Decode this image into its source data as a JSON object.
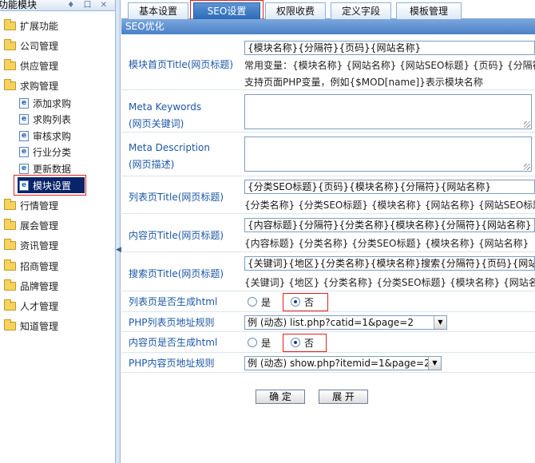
{
  "sidebar": {
    "header_title": "功能模块",
    "header_controls": "♦ 口 ✕",
    "folders": [
      {
        "label": "扩展功能"
      },
      {
        "label": "公司管理"
      },
      {
        "label": "供应管理"
      },
      {
        "label": "求购管理"
      },
      {
        "label": "行情管理"
      },
      {
        "label": "展会管理"
      },
      {
        "label": "资讯管理"
      },
      {
        "label": "招商管理"
      },
      {
        "label": "品牌管理"
      },
      {
        "label": "人才管理"
      },
      {
        "label": "知道管理"
      }
    ],
    "leaves": [
      {
        "label": "添加求购"
      },
      {
        "label": "求购列表"
      },
      {
        "label": "审核求购"
      },
      {
        "label": "行业分类"
      },
      {
        "label": "更新数据"
      },
      {
        "label": "模块设置"
      }
    ]
  },
  "tabs": [
    "基本设置",
    "SEO设置",
    "权限收费",
    "定义字段",
    "模板管理"
  ],
  "section_title": "SEO优化",
  "form": {
    "home_title": {
      "label": "模块首页Title(网页标题)",
      "value": "{模块名称}{分隔符}{页码}{网站名称}",
      "hint1": "常用变量：{模块名称} {网站名称} {网站SEO标题} {页码} {分隔符}",
      "hint2": "支持页面PHP变量，例如{$MOD[name]}表示模块名称"
    },
    "meta_keywords": {
      "label1": "Meta Keywords",
      "label2": "(网页关键词)"
    },
    "meta_description": {
      "label1": "Meta Description",
      "label2": "(网页描述)"
    },
    "list_title": {
      "label": "列表页Title(网页标题)",
      "value": "{分类SEO标题}{页码}{模块名称}{分隔符}{网站名称}",
      "hint": "{分类名称} {分类SEO标题} {模块名称} {网站名称} {网站SEO标题}"
    },
    "content_title": {
      "label": "内容页Title(网页标题)",
      "value": "{内容标题}{分隔符}{分类名称}{模块名称}{分隔符}{网站名称}",
      "hint": "{内容标题} {分类名称} {分类SEO标题} {模块名称} {网站名称}"
    },
    "search_title": {
      "label": "搜索页Title(网页标题)",
      "value": "{关键词}{地区}{分类名称}{模块名称}搜索{分隔符}{页码}{网站名称}",
      "hint": "{关键词} {地区} {分类名称} {分类SEO标题} {模块名称} {网站名称}"
    },
    "list_html": {
      "label": "列表页是否生成html",
      "yes": "是",
      "no": "否",
      "selected": "否"
    },
    "php_list_rule": {
      "label": "PHP列表页地址规则",
      "value": "例 (动态) list.php?catid=1&page=2"
    },
    "content_html": {
      "label": "内容页是否生成html",
      "yes": "是",
      "no": "否",
      "selected": "否"
    },
    "php_content_rule": {
      "label": "PHP内容页地址规则",
      "value": "例 (动态) show.php?itemid=1&page=2"
    }
  },
  "buttons": {
    "confirm": "确 定",
    "reset": "展 开"
  },
  "colors": {
    "accent": "#2c6ab6",
    "label": "#1c57a5",
    "highlight": "#e0201b",
    "active_nav": "#0a246a"
  }
}
